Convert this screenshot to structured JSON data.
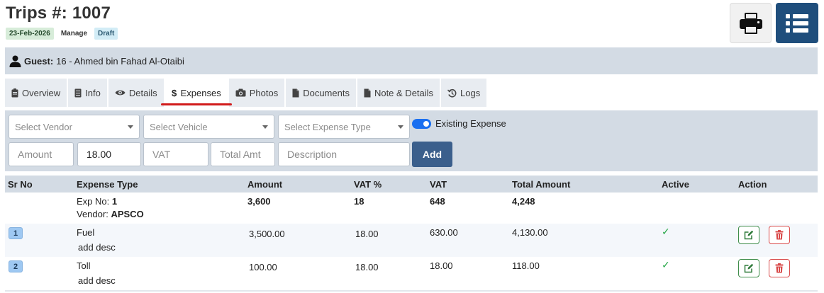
{
  "header": {
    "title": "Trips #: 1007",
    "date_badge": "23-Feb-2026",
    "manage_label": "Manage",
    "status_badge": "Draft"
  },
  "guest": {
    "label": "Guest:",
    "value": "16 - Ahmed bin Fahad Al-Otaibi"
  },
  "tabs": [
    {
      "label": "Overview",
      "icon": "clipboard-icon"
    },
    {
      "label": "Info",
      "icon": "document-icon"
    },
    {
      "label": "Details",
      "icon": "eye-icon"
    },
    {
      "label": "Expenses",
      "icon": "dollar-icon",
      "active": true
    },
    {
      "label": "Photos",
      "icon": "camera-icon"
    },
    {
      "label": "Documents",
      "icon": "file-icon"
    },
    {
      "label": "Note & Details",
      "icon": "file-icon"
    },
    {
      "label": "Logs",
      "icon": "history-icon"
    }
  ],
  "form": {
    "vendor_placeholder": "Select Vendor",
    "vehicle_placeholder": "Select Vehicle",
    "expense_type_placeholder": "Select Expense Type",
    "existing_expense_label": "Existing Expense",
    "existing_expense_enabled": true,
    "amount_placeholder": "Amount",
    "vat_pct_value": "18.00",
    "vat_placeholder": "VAT",
    "total_placeholder": "Total Amt",
    "description_placeholder": "Description",
    "add_label": "Add"
  },
  "table": {
    "columns": [
      "Sr No",
      "Expense Type",
      "Amount",
      "VAT %",
      "VAT",
      "Total Amount",
      "Active",
      "Action"
    ],
    "summary": {
      "exp_no_label": "Exp No:",
      "exp_no": "1",
      "vendor_label": "Vendor:",
      "vendor": "APSCO",
      "amount": "3,600",
      "vat_pct": "18",
      "vat": "648",
      "total": "4,248"
    },
    "rows": [
      {
        "sr": "1",
        "type": "Fuel",
        "desc": "add desc",
        "amount": "3,500.00",
        "vat_pct": "18.00",
        "vat": "630.00",
        "total": "4,130.00",
        "active": "✓"
      },
      {
        "sr": "2",
        "type": "Toll",
        "desc": "add desc",
        "amount": "100.00",
        "vat_pct": "18.00",
        "vat": "18.00",
        "total": "118.00",
        "active": "✓"
      }
    ]
  },
  "colors": {
    "primary": "#1f4e7c",
    "panel": "#d3dbe4",
    "active_tab_underline": "#d11b1b",
    "toggle_on": "#1a6ff0",
    "success": "#2aa84a",
    "danger": "#d94b4b"
  }
}
